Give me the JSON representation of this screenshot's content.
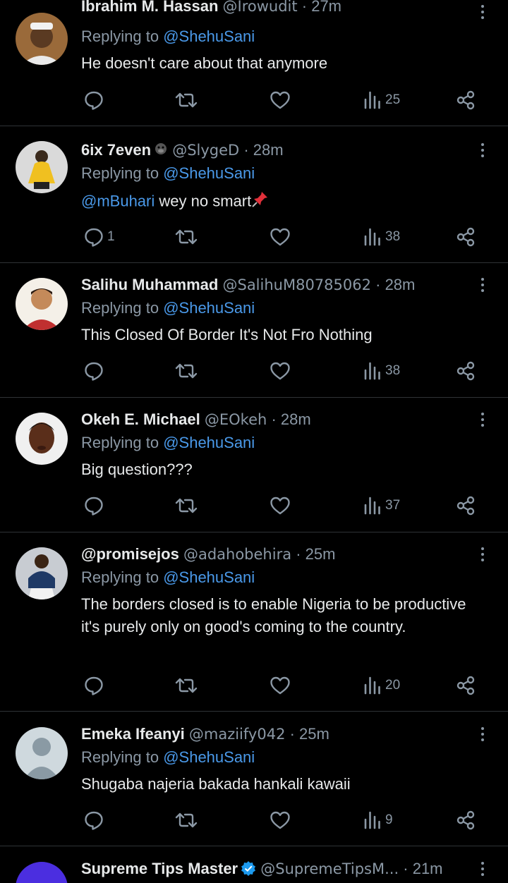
{
  "tweets": [
    {
      "name": "Ibrahim M. Hassan",
      "handle": "@Irowudit",
      "time": "27m",
      "replying_label": "Replying to",
      "replying_to": "@ShehuSani",
      "text": "He doesn't care about that anymore",
      "reply_count": "",
      "views": "25"
    },
    {
      "name": "6ix 7even",
      "handle": "@SlygeD",
      "time": "28m",
      "replying_label": "Replying to",
      "replying_to": "@ShehuSani",
      "text_mention": "@mBuhari",
      "text": " wey no smart",
      "reply_count": "1",
      "views": "38"
    },
    {
      "name": "Salihu Muhammad",
      "handle": "@SalihuM80785062",
      "time": "28m",
      "replying_label": "Replying to",
      "replying_to": "@ShehuSani",
      "text": "This Closed Of Border It's Not Fro Nothing",
      "reply_count": "",
      "views": "38"
    },
    {
      "name": "Okeh E. Michael",
      "handle": "@EOkeh",
      "time": "28m",
      "replying_label": "Replying to",
      "replying_to": "@ShehuSani",
      "text": "Big question???",
      "reply_count": "",
      "views": "37"
    },
    {
      "name": "@promisejos",
      "handle": "@adahobehira",
      "time": "25m",
      "replying_label": "Replying to",
      "replying_to": "@ShehuSani",
      "text": "The borders closed is to enable Nigeria to be productive it's purely only on good's coming to the country.",
      "reply_count": "",
      "views": "20"
    },
    {
      "name": "Emeka Ifeanyi",
      "handle": "@maziify042",
      "time": "25m",
      "replying_label": "Replying to",
      "replying_to": "@ShehuSani",
      "text": "Shugaba najeria bakada hankali kawaii",
      "reply_count": "",
      "views": "9"
    },
    {
      "name": "Supreme Tips Master",
      "handle": "@SupremeTipsM...",
      "time": "21m"
    }
  ],
  "separator": "·",
  "colors": {
    "background": "#000000",
    "text": "#e7e9ea",
    "secondary": "#8b98a5",
    "mention": "#4a99e9",
    "divider": "#2f3336",
    "verified": "#1d9bf0"
  },
  "icons": {
    "reply": "reply-icon",
    "retweet": "retweet-icon",
    "like": "heart-icon",
    "views": "views-icon",
    "share": "share-icon",
    "more": "more-icon",
    "verified": "verified-badge-icon"
  }
}
